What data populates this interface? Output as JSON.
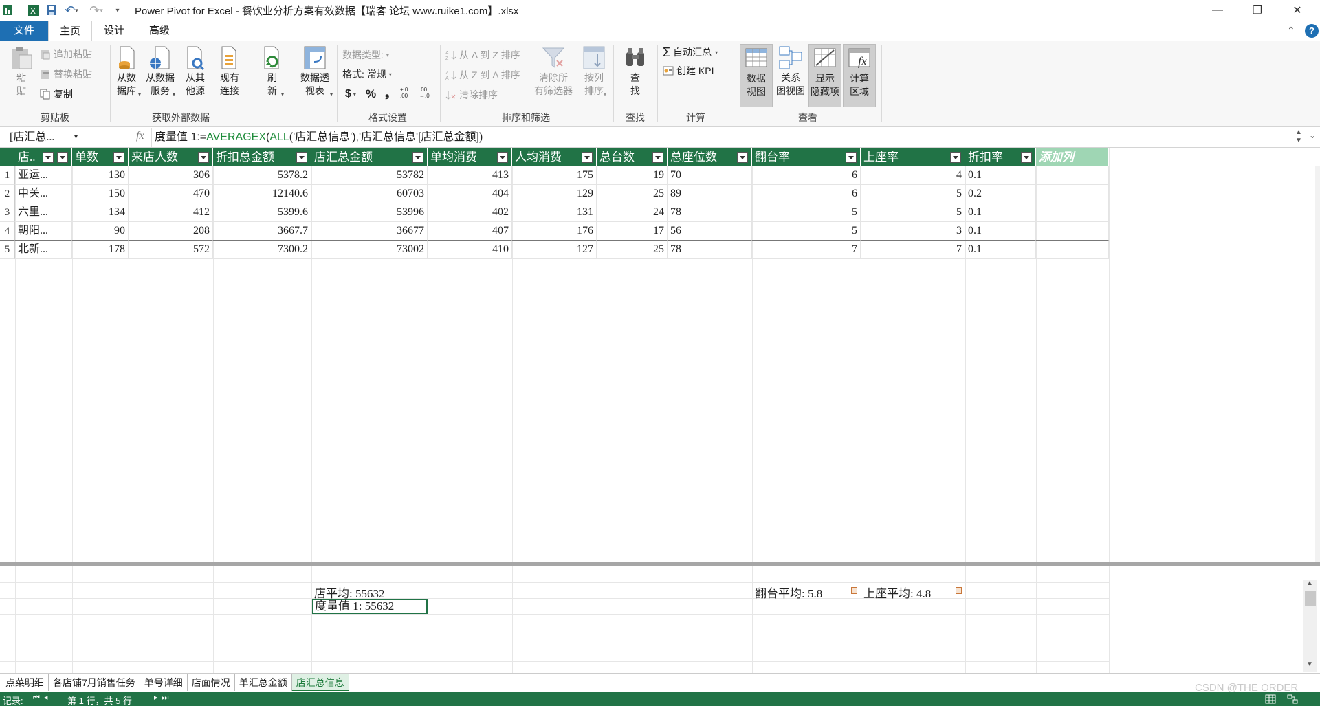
{
  "window": {
    "title": "Power Pivot for Excel - 餐饮业分析方案有效数据【瑞客 论坛 www.ruike1.com】.xlsx",
    "minimize": "—",
    "restore": "❐",
    "close": "✕"
  },
  "tabs": [
    {
      "label": "文件"
    },
    {
      "label": "主页"
    },
    {
      "label": "设计"
    },
    {
      "label": "高级"
    }
  ],
  "help": "?",
  "ribbon": {
    "clipboard": {
      "paste": "粘\n贴",
      "append_paste": "追加粘贴",
      "replace_paste": "替换粘贴",
      "copy": "复制",
      "label": "剪贴板"
    },
    "external": {
      "from_db": "从数\n据库",
      "from_service": "从数据\n服务",
      "from_other": "从其\n他源",
      "existing": "现有\n连接",
      "label": "获取外部数据"
    },
    "refresh": "刷\n新",
    "pivot": "数据透\n视表",
    "format": {
      "data_type": "数据类型:",
      "format": "格式: 常规",
      "currency": "$",
      "percent": "%",
      "comma": "❟",
      "inc": "+.0\n.00",
      "dec": ".00\n→.0",
      "label": "格式设置"
    },
    "sort": {
      "a_to_z": "从 A 到 Z 排序",
      "z_to_a": "从 Z 到 A 排序",
      "clear_sort": "清除排序",
      "clear_filters": "清除所\n有筛选器",
      "sort_by_col": "按列\n排序",
      "label": "排序和筛选"
    },
    "find": {
      "btn": "查\n找",
      "label": "查找"
    },
    "calc": {
      "autosum": "自动汇总",
      "kpi": "创建 KPI",
      "label": "计算"
    },
    "view": {
      "data_view": "数据\n视图",
      "diagram_view": "关系\n图视图",
      "show_hidden": "显示\n隐藏项",
      "calc_area": "计算\n区域",
      "label": "查看"
    }
  },
  "formula_bar": {
    "name_box": "[店汇总...",
    "fx": "fx",
    "formula_prefix": "度量值 1:=",
    "formula_fn": "AVERAGEX",
    "formula_paren": "(",
    "formula_all": "ALL",
    "formula_rest": "('店汇总信息'),'店汇总信息'[店汇总金额])"
  },
  "table": {
    "columns": [
      "店..",
      "单数",
      "来店人数",
      "折扣总金额",
      "店汇总金额",
      "单均消费",
      "人均消费",
      "总台数",
      "总座位数",
      "翻台率",
      "上座率",
      "折扣率",
      "添加列"
    ],
    "rows": [
      {
        "n": "1",
        "cells": [
          "亚运...",
          "130",
          "306",
          "5378.2",
          "53782",
          "413",
          "175",
          "19",
          "70",
          "6",
          "4",
          "0.1"
        ]
      },
      {
        "n": "2",
        "cells": [
          "中关...",
          "150",
          "470",
          "12140.6",
          "60703",
          "404",
          "129",
          "25",
          "89",
          "6",
          "5",
          "0.2"
        ]
      },
      {
        "n": "3",
        "cells": [
          "六里...",
          "134",
          "412",
          "5399.6",
          "53996",
          "402",
          "131",
          "24",
          "78",
          "5",
          "5",
          "0.1"
        ]
      },
      {
        "n": "4",
        "cells": [
          "朝阳...",
          "90",
          "208",
          "3667.7",
          "36677",
          "407",
          "176",
          "17",
          "56",
          "5",
          "3",
          "0.1"
        ]
      },
      {
        "n": "5",
        "cells": [
          "北新...",
          "178",
          "572",
          "7300.2",
          "73002",
          "410",
          "127",
          "25",
          "78",
          "7",
          "7",
          "0.1"
        ]
      }
    ]
  },
  "measures": {
    "store_avg": "店平均: 55632",
    "measure1": "度量值 1: 55632",
    "turn_avg": "翻台平均: 5.8",
    "seat_avg": "上座平均: 4.8"
  },
  "sheets": [
    {
      "label": "点菜明细"
    },
    {
      "label": "各店铺7月销售任务"
    },
    {
      "label": "单号详细"
    },
    {
      "label": "店面情况"
    },
    {
      "label": "单汇总金额"
    },
    {
      "label": "店汇总信息"
    }
  ],
  "status": {
    "record": "记录:",
    "position": "第 1 行，共 5 行"
  },
  "watermark": "CSDN @THE ORDER",
  "colors": {
    "header_green": "#217346",
    "file_blue": "#1e6fb3",
    "formula_green": "#1e8c3a"
  }
}
